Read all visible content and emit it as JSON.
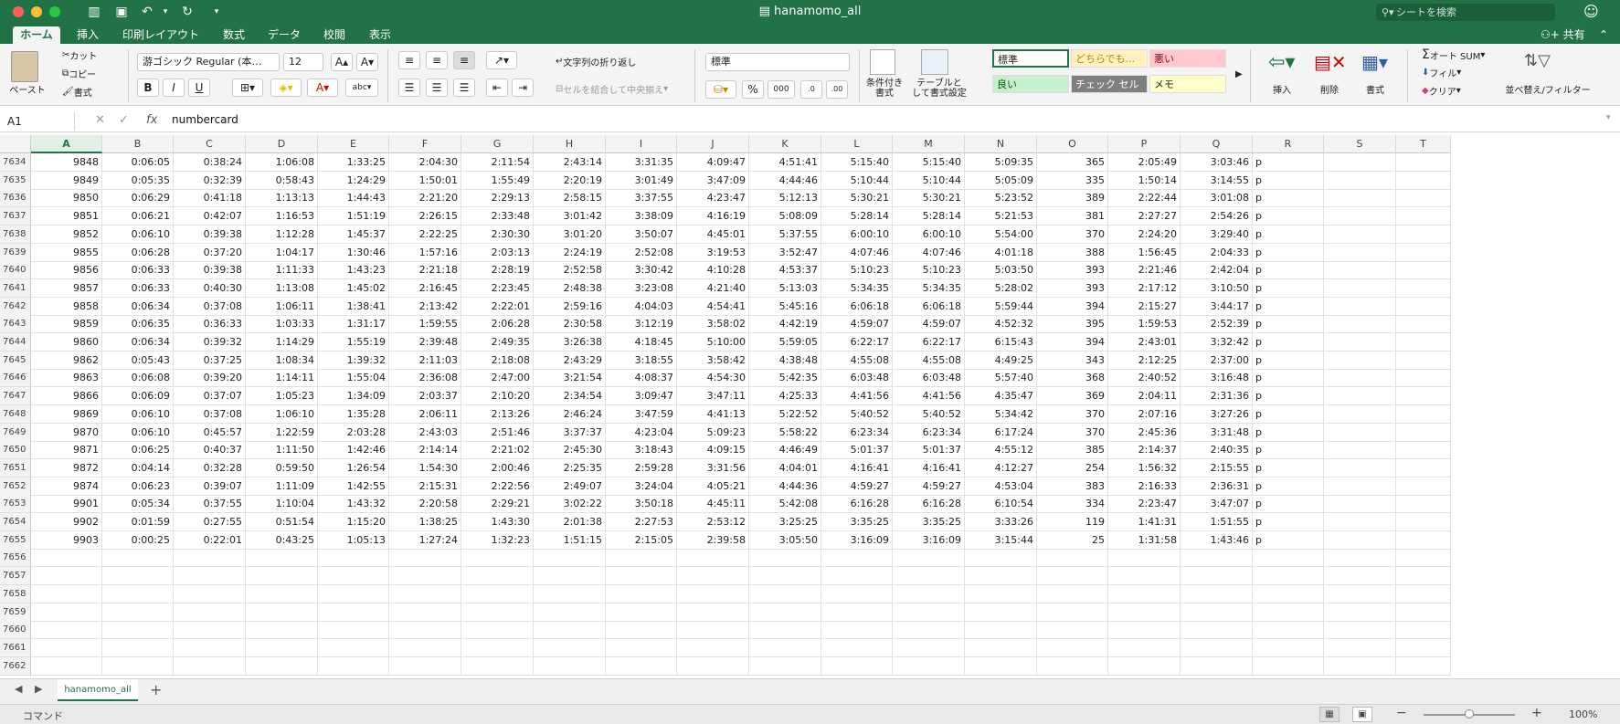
{
  "window": {
    "title": "hanamomo_all",
    "search_placeholder": "シートを検索"
  },
  "ribbon_tabs": [
    {
      "label": "ホーム",
      "active": true
    },
    {
      "label": "挿入"
    },
    {
      "label": "印刷レイアウト"
    },
    {
      "label": "数式"
    },
    {
      "label": "データ"
    },
    {
      "label": "校閲"
    },
    {
      "label": "表示"
    }
  ],
  "share_label": "共有",
  "ribbon": {
    "paste": "ペースト",
    "cut": "カット",
    "copy": "コピー",
    "format_painter": "書式",
    "font_name": "游ゴシック Regular (本…",
    "font_size": "12",
    "wrap_text": "文字列の折り返し",
    "merge_center": "セルを結合して中央揃え",
    "number_format": "標準",
    "conditional_format": "条件付き\n書式",
    "table_format": "テーブルと\nして書式設定",
    "styles": [
      {
        "label": "標準",
        "bg": "#ffffff",
        "color": "#222222"
      },
      {
        "label": "どちらでも...",
        "bg": "#fff2bf",
        "color": "#b8860b"
      },
      {
        "label": "悪い",
        "bg": "#ffc7ce",
        "color": "#9c0006"
      },
      {
        "label": "良い",
        "bg": "#c6efce",
        "color": "#006100"
      },
      {
        "label": "チェック セル",
        "bg": "#7f7f7f",
        "color": "#ffffff"
      },
      {
        "label": "メモ",
        "bg": "#ffffcc",
        "color": "#222222"
      }
    ],
    "insert": "挿入",
    "delete": "削除",
    "format": "書式",
    "autosum": "オート SUM",
    "fill": "フィル",
    "clear": "クリア",
    "sort_filter": "並べ替え/フィルター"
  },
  "formula_bar": {
    "name_box": "A1",
    "fx": "fx",
    "content": "numbercard"
  },
  "columns": [
    "A",
    "B",
    "C",
    "D",
    "E",
    "F",
    "G",
    "H",
    "I",
    "J",
    "K",
    "L",
    "M",
    "N",
    "O",
    "P",
    "Q",
    "R",
    "S",
    "T"
  ],
  "selected_column": "A",
  "rows": [
    {
      "n": "7634",
      "v": [
        "9848",
        "0:06:05",
        "0:38:24",
        "1:06:08",
        "1:33:25",
        "2:04:30",
        "2:11:54",
        "2:43:14",
        "3:31:35",
        "4:09:47",
        "4:51:41",
        "5:15:40",
        "5:15:40",
        "5:09:35",
        "365",
        "2:05:49",
        "3:03:46",
        "p"
      ]
    },
    {
      "n": "7635",
      "v": [
        "9849",
        "0:05:35",
        "0:32:39",
        "0:58:43",
        "1:24:29",
        "1:50:01",
        "1:55:49",
        "2:20:19",
        "3:01:49",
        "3:47:09",
        "4:44:46",
        "5:10:44",
        "5:10:44",
        "5:05:09",
        "335",
        "1:50:14",
        "3:14:55",
        "p"
      ]
    },
    {
      "n": "7636",
      "v": [
        "9850",
        "0:06:29",
        "0:41:18",
        "1:13:13",
        "1:44:43",
        "2:21:20",
        "2:29:13",
        "2:58:15",
        "3:37:55",
        "4:23:47",
        "5:12:13",
        "5:30:21",
        "5:30:21",
        "5:23:52",
        "389",
        "2:22:44",
        "3:01:08",
        "p"
      ]
    },
    {
      "n": "7637",
      "v": [
        "9851",
        "0:06:21",
        "0:42:07",
        "1:16:53",
        "1:51:19",
        "2:26:15",
        "2:33:48",
        "3:01:42",
        "3:38:09",
        "4:16:19",
        "5:08:09",
        "5:28:14",
        "5:28:14",
        "5:21:53",
        "381",
        "2:27:27",
        "2:54:26",
        "p"
      ]
    },
    {
      "n": "7638",
      "v": [
        "9852",
        "0:06:10",
        "0:39:38",
        "1:12:28",
        "1:45:37",
        "2:22:25",
        "2:30:30",
        "3:01:20",
        "3:50:07",
        "4:45:01",
        "5:37:55",
        "6:00:10",
        "6:00:10",
        "5:54:00",
        "370",
        "2:24:20",
        "3:29:40",
        "p"
      ]
    },
    {
      "n": "7639",
      "v": [
        "9855",
        "0:06:28",
        "0:37:20",
        "1:04:17",
        "1:30:46",
        "1:57:16",
        "2:03:13",
        "2:24:19",
        "2:52:08",
        "3:19:53",
        "3:52:47",
        "4:07:46",
        "4:07:46",
        "4:01:18",
        "388",
        "1:56:45",
        "2:04:33",
        "p"
      ]
    },
    {
      "n": "7640",
      "v": [
        "9856",
        "0:06:33",
        "0:39:38",
        "1:11:33",
        "1:43:23",
        "2:21:18",
        "2:28:19",
        "2:52:58",
        "3:30:42",
        "4:10:28",
        "4:53:37",
        "5:10:23",
        "5:10:23",
        "5:03:50",
        "393",
        "2:21:46",
        "2:42:04",
        "p"
      ]
    },
    {
      "n": "7641",
      "v": [
        "9857",
        "0:06:33",
        "0:40:30",
        "1:13:08",
        "1:45:02",
        "2:16:45",
        "2:23:45",
        "2:48:38",
        "3:23:08",
        "4:21:40",
        "5:13:03",
        "5:34:35",
        "5:34:35",
        "5:28:02",
        "393",
        "2:17:12",
        "3:10:50",
        "p"
      ]
    },
    {
      "n": "7642",
      "v": [
        "9858",
        "0:06:34",
        "0:37:08",
        "1:06:11",
        "1:38:41",
        "2:13:42",
        "2:22:01",
        "2:59:16",
        "4:04:03",
        "4:54:41",
        "5:45:16",
        "6:06:18",
        "6:06:18",
        "5:59:44",
        "394",
        "2:15:27",
        "3:44:17",
        "p"
      ]
    },
    {
      "n": "7643",
      "v": [
        "9859",
        "0:06:35",
        "0:36:33",
        "1:03:33",
        "1:31:17",
        "1:59:55",
        "2:06:28",
        "2:30:58",
        "3:12:19",
        "3:58:02",
        "4:42:19",
        "4:59:07",
        "4:59:07",
        "4:52:32",
        "395",
        "1:59:53",
        "2:52:39",
        "p"
      ]
    },
    {
      "n": "7644",
      "v": [
        "9860",
        "0:06:34",
        "0:39:32",
        "1:14:29",
        "1:55:19",
        "2:39:48",
        "2:49:35",
        "3:26:38",
        "4:18:45",
        "5:10:00",
        "5:59:05",
        "6:22:17",
        "6:22:17",
        "6:15:43",
        "394",
        "2:43:01",
        "3:32:42",
        "p"
      ]
    },
    {
      "n": "7645",
      "v": [
        "9862",
        "0:05:43",
        "0:37:25",
        "1:08:34",
        "1:39:32",
        "2:11:03",
        "2:18:08",
        "2:43:29",
        "3:18:55",
        "3:58:42",
        "4:38:48",
        "4:55:08",
        "4:55:08",
        "4:49:25",
        "343",
        "2:12:25",
        "2:37:00",
        "p"
      ]
    },
    {
      "n": "7646",
      "v": [
        "9863",
        "0:06:08",
        "0:39:20",
        "1:14:11",
        "1:55:04",
        "2:36:08",
        "2:47:00",
        "3:21:54",
        "4:08:37",
        "4:54:30",
        "5:42:35",
        "6:03:48",
        "6:03:48",
        "5:57:40",
        "368",
        "2:40:52",
        "3:16:48",
        "p"
      ]
    },
    {
      "n": "7647",
      "v": [
        "9866",
        "0:06:09",
        "0:37:07",
        "1:05:23",
        "1:34:09",
        "2:03:37",
        "2:10:20",
        "2:34:54",
        "3:09:47",
        "3:47:11",
        "4:25:33",
        "4:41:56",
        "4:41:56",
        "4:35:47",
        "369",
        "2:04:11",
        "2:31:36",
        "p"
      ]
    },
    {
      "n": "7648",
      "v": [
        "9869",
        "0:06:10",
        "0:37:08",
        "1:06:10",
        "1:35:28",
        "2:06:11",
        "2:13:26",
        "2:46:24",
        "3:47:59",
        "4:41:13",
        "5:22:52",
        "5:40:52",
        "5:40:52",
        "5:34:42",
        "370",
        "2:07:16",
        "3:27:26",
        "p"
      ]
    },
    {
      "n": "7649",
      "v": [
        "9870",
        "0:06:10",
        "0:45:57",
        "1:22:59",
        "2:03:28",
        "2:43:03",
        "2:51:46",
        "3:37:37",
        "4:23:04",
        "5:09:23",
        "5:58:22",
        "6:23:34",
        "6:23:34",
        "6:17:24",
        "370",
        "2:45:36",
        "3:31:48",
        "p"
      ]
    },
    {
      "n": "7650",
      "v": [
        "9871",
        "0:06:25",
        "0:40:37",
        "1:11:50",
        "1:42:46",
        "2:14:14",
        "2:21:02",
        "2:45:30",
        "3:18:43",
        "4:09:15",
        "4:46:49",
        "5:01:37",
        "5:01:37",
        "4:55:12",
        "385",
        "2:14:37",
        "2:40:35",
        "p"
      ]
    },
    {
      "n": "7651",
      "v": [
        "9872",
        "0:04:14",
        "0:32:28",
        "0:59:50",
        "1:26:54",
        "1:54:30",
        "2:00:46",
        "2:25:35",
        "2:59:28",
        "3:31:56",
        "4:04:01",
        "4:16:41",
        "4:16:41",
        "4:12:27",
        "254",
        "1:56:32",
        "2:15:55",
        "p"
      ]
    },
    {
      "n": "7652",
      "v": [
        "9874",
        "0:06:23",
        "0:39:07",
        "1:11:09",
        "1:42:55",
        "2:15:31",
        "2:22:56",
        "2:49:07",
        "3:24:04",
        "4:05:21",
        "4:44:36",
        "4:59:27",
        "4:59:27",
        "4:53:04",
        "383",
        "2:16:33",
        "2:36:31",
        "p"
      ]
    },
    {
      "n": "7653",
      "v": [
        "9901",
        "0:05:34",
        "0:37:55",
        "1:10:04",
        "1:43:32",
        "2:20:58",
        "2:29:21",
        "3:02:22",
        "3:50:18",
        "4:45:11",
        "5:42:08",
        "6:16:28",
        "6:16:28",
        "6:10:54",
        "334",
        "2:23:47",
        "3:47:07",
        "p"
      ]
    },
    {
      "n": "7654",
      "v": [
        "9902",
        "0:01:59",
        "0:27:55",
        "0:51:54",
        "1:15:20",
        "1:38:25",
        "1:43:30",
        "2:01:38",
        "2:27:53",
        "2:53:12",
        "3:25:25",
        "3:35:25",
        "3:35:25",
        "3:33:26",
        "119",
        "1:41:31",
        "1:51:55",
        "p"
      ]
    },
    {
      "n": "7655",
      "v": [
        "9903",
        "0:00:25",
        "0:22:01",
        "0:43:25",
        "1:05:13",
        "1:27:24",
        "1:32:23",
        "1:51:15",
        "2:15:05",
        "2:39:58",
        "3:05:50",
        "3:16:09",
        "3:16:09",
        "3:15:44",
        "25",
        "1:31:58",
        "1:43:46",
        "p"
      ]
    },
    {
      "n": "7656",
      "v": []
    },
    {
      "n": "7657",
      "v": []
    },
    {
      "n": "7658",
      "v": []
    },
    {
      "n": "7659",
      "v": []
    },
    {
      "n": "7660",
      "v": []
    },
    {
      "n": "7661",
      "v": []
    },
    {
      "n": "7662",
      "v": []
    }
  ],
  "sheet_tab": "hanamomo_all",
  "status": {
    "mode": "コマンド",
    "zoom": "100%"
  },
  "colors": {
    "accent": "#217346"
  }
}
